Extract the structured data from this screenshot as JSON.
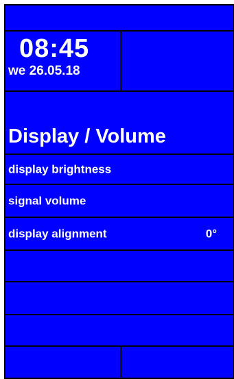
{
  "clock": {
    "time": "08:45",
    "date": "we 26.05.18"
  },
  "section": {
    "title": "Display / Volume"
  },
  "menu": {
    "items": [
      {
        "label": "display brightness",
        "value": ""
      },
      {
        "label": "signal volume",
        "value": ""
      },
      {
        "label": "display alignment",
        "value": "0°"
      }
    ]
  },
  "colors": {
    "background": "#0000ff",
    "text": "#ffffff",
    "border": "#000000"
  }
}
